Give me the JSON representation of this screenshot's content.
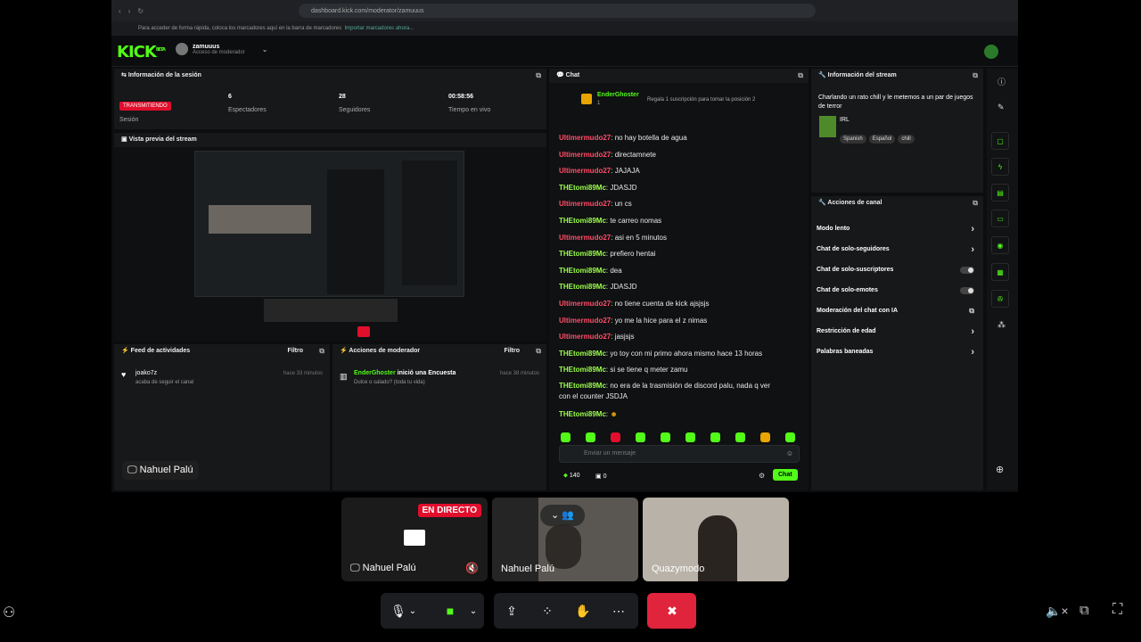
{
  "browser": {
    "url": "dashboard.kick.com/moderator/zamuuus",
    "bookmark_hint": "Para acceder de forma rápida, coloca los marcadores aquí en la barra de marcadores",
    "bookmark_import": "Importar marcadores ahora..."
  },
  "header": {
    "logo": "KICK",
    "logo_badge": "BETA",
    "account_name": "zamuuus",
    "account_role": "Acceso de moderador"
  },
  "session": {
    "title": "Información de la sesión",
    "status": "TRANSMITIENDO",
    "status_label": "Sesión",
    "viewers": "6",
    "viewers_label": "Espectadores",
    "followers": "28",
    "followers_label": "Seguidores",
    "time": "00:58:56",
    "time_label": "Tiempo en vivo"
  },
  "preview": {
    "title": "Vista previa del stream"
  },
  "activity": {
    "title": "Feed de actividades",
    "filter": "Filtro",
    "user": "joako7z",
    "action": "acaba de seguir el canal",
    "time": "hace 33 minutos"
  },
  "modactions": {
    "title": "Acciones de moderador",
    "filter": "Filtro",
    "user": "EnderGhoster",
    "action": "inició una Encuesta",
    "detail": "Dulce o salado? (toda tu vida)",
    "time": "hace 38 minutos"
  },
  "presenter_label": "Nahuel Palú",
  "chat": {
    "title": "Chat",
    "pinned_user": "EnderGhoster",
    "pinned_count": "1",
    "pinned_msg": "Regala 1 suscripción para tomar la posición 2",
    "messages": [
      {
        "user": "Ultimermudo27",
        "msg": "no hay botella de agua",
        "cls": "u1"
      },
      {
        "user": "Ultimermudo27",
        "msg": "directamnete",
        "cls": "u1"
      },
      {
        "user": "Ultimermudo27",
        "msg": "JAJAJA",
        "cls": "u1"
      },
      {
        "user": "THEtomi89Mc",
        "msg": "JDASJD",
        "cls": "u2"
      },
      {
        "user": "Ultimermudo27",
        "msg": "un cs",
        "cls": "u1"
      },
      {
        "user": "THEtomi89Mc",
        "msg": "te carreo nomas",
        "cls": "u2"
      },
      {
        "user": "Ultimermudo27",
        "msg": "asi en 5 minutos",
        "cls": "u1"
      },
      {
        "user": "THEtomi89Mc",
        "msg": "prefiero hentai",
        "cls": "u2"
      },
      {
        "user": "THEtomi89Mc",
        "msg": "dea",
        "cls": "u2"
      },
      {
        "user": "THEtomi89Mc",
        "msg": "JDASJD",
        "cls": "u2"
      },
      {
        "user": "Ultimermudo27",
        "msg": "no tiene cuenta de kick ajsjsjs",
        "cls": "u1"
      },
      {
        "user": "Ultimermudo27",
        "msg": "yo me la hice para el z nimas",
        "cls": "u1"
      },
      {
        "user": "Ultimermudo27",
        "msg": "jasjsjs",
        "cls": "u1"
      },
      {
        "user": "THEtomi89Mc",
        "msg": "yo toy con mi primo ahora mismo hace 13 horas",
        "cls": "u2"
      },
      {
        "user": "THEtomi89Mc",
        "msg": "si se tiene q meter zamu",
        "cls": "u2"
      }
    ],
    "long_user": "THEtomi89Mc",
    "long_msg_1": "no era de la trasmisión de discord palu, nada q ver",
    "long_msg_2": "con el counter JSDJA",
    "last_user": "THEtomi89Mc",
    "input_placeholder": "Enviar un mensaje",
    "points": "140",
    "gifts": "0",
    "send": "Chat"
  },
  "streaminfo": {
    "title": "Información del stream",
    "desc": "Charlando un rato chill y le metemos a un par de juegos de terror",
    "category": "IRL",
    "tags": [
      "Spanish",
      "Español",
      "chill"
    ]
  },
  "channel": {
    "title": "Acciones de canal",
    "items": [
      {
        "label": "Modo lento",
        "ctrl": "arrow"
      },
      {
        "label": "Chat de solo-seguidores",
        "ctrl": "arrow"
      },
      {
        "label": "Chat de solo-suscriptores",
        "ctrl": "toggle"
      },
      {
        "label": "Chat de solo-emotes",
        "ctrl": "toggle"
      },
      {
        "label": "Moderación del chat con IA",
        "ctrl": "ext"
      },
      {
        "label": "Restricción de edad",
        "ctrl": "arrow"
      },
      {
        "label": "Palabras baneadas",
        "ctrl": "arrow"
      }
    ]
  },
  "call": {
    "live_badge": "EN DIRECTO",
    "tile1": "Nahuel Palú",
    "tile2": "Nahuel Palú",
    "tile3": "Quazymodo"
  },
  "colors": {
    "kick_green": "#53fc18",
    "live_red": "#e10e2c",
    "leave_red": "#e0243b"
  }
}
